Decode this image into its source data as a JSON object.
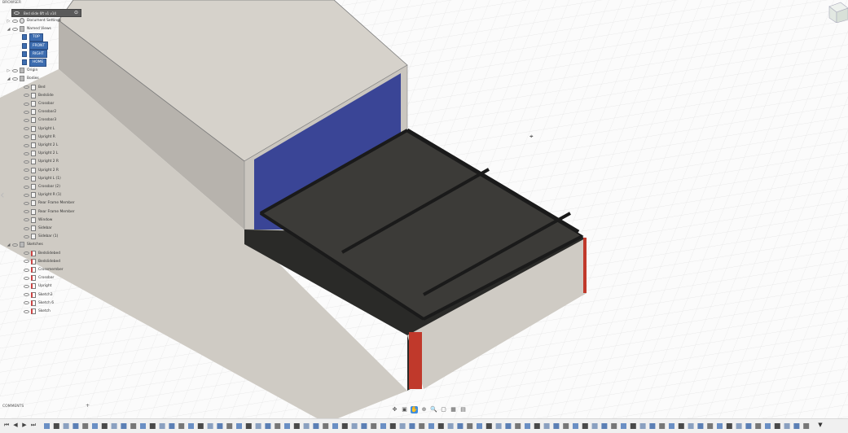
{
  "browser": {
    "title": "BROWSER",
    "document": "Bed slide 6ft v1 v14",
    "items": [
      {
        "label": "Document Settings",
        "indent": 0,
        "icon": "gear",
        "tri": "▷"
      },
      {
        "label": "Named Views",
        "indent": 0,
        "icon": "folder",
        "tri": "◢"
      },
      {
        "label": "TOP",
        "indent": 1,
        "icon": "view",
        "tri": "",
        "view": true
      },
      {
        "label": "FRONT",
        "indent": 1,
        "icon": "view",
        "tri": "",
        "view": true
      },
      {
        "label": "RIGHT",
        "indent": 1,
        "icon": "view",
        "tri": "",
        "view": true
      },
      {
        "label": "HOME",
        "indent": 1,
        "icon": "view",
        "tri": "",
        "view": true
      },
      {
        "label": "Origin",
        "indent": 0,
        "icon": "folder",
        "tri": "▷"
      },
      {
        "label": "Bodies",
        "indent": 0,
        "icon": "folder",
        "tri": "◢"
      },
      {
        "label": "Bed",
        "indent": 1,
        "icon": "body",
        "tri": ""
      },
      {
        "label": "Bedslide",
        "indent": 1,
        "icon": "body",
        "tri": ""
      },
      {
        "label": "Crossbar",
        "indent": 1,
        "icon": "body",
        "tri": ""
      },
      {
        "label": "Crossbar2",
        "indent": 1,
        "icon": "body",
        "tri": ""
      },
      {
        "label": "Crossbar3",
        "indent": 1,
        "icon": "body",
        "tri": ""
      },
      {
        "label": "Upright L",
        "indent": 1,
        "icon": "body",
        "tri": ""
      },
      {
        "label": "Upright R",
        "indent": 1,
        "icon": "body",
        "tri": ""
      },
      {
        "label": "Upright 2 L",
        "indent": 1,
        "icon": "body",
        "tri": ""
      },
      {
        "label": "Upright 2 L",
        "indent": 1,
        "icon": "body",
        "tri": ""
      },
      {
        "label": "Upright 2 R",
        "indent": 1,
        "icon": "body",
        "tri": ""
      },
      {
        "label": "Upright 2 R",
        "indent": 1,
        "icon": "body",
        "tri": ""
      },
      {
        "label": "Upright L (1)",
        "indent": 1,
        "icon": "body",
        "tri": ""
      },
      {
        "label": "Crossbar (2)",
        "indent": 1,
        "icon": "body",
        "tri": ""
      },
      {
        "label": "Upright R (1)",
        "indent": 1,
        "icon": "body",
        "tri": ""
      },
      {
        "label": "Rear Frame Member",
        "indent": 1,
        "icon": "body",
        "tri": ""
      },
      {
        "label": "Rear Frame Member",
        "indent": 1,
        "icon": "body",
        "tri": ""
      },
      {
        "label": "Window",
        "indent": 1,
        "icon": "body",
        "tri": ""
      },
      {
        "label": "Sidebar",
        "indent": 1,
        "icon": "body",
        "tri": ""
      },
      {
        "label": "Sidebar (1)",
        "indent": 1,
        "icon": "body",
        "tri": ""
      },
      {
        "label": "Sketches",
        "indent": 0,
        "icon": "folder",
        "tri": "◢"
      },
      {
        "label": "Bedslidebed",
        "indent": 1,
        "icon": "sketch",
        "tri": ""
      },
      {
        "label": "Bedslidebed",
        "indent": 1,
        "icon": "sketch",
        "tri": ""
      },
      {
        "label": "Crossmember",
        "indent": 1,
        "icon": "sketch",
        "tri": ""
      },
      {
        "label": "Crossbar",
        "indent": 1,
        "icon": "sketch",
        "tri": ""
      },
      {
        "label": "Upright",
        "indent": 1,
        "icon": "sketch",
        "tri": ""
      },
      {
        "label": "Sketch3",
        "indent": 1,
        "icon": "sketch",
        "tri": ""
      },
      {
        "label": "Sketch 6",
        "indent": 1,
        "icon": "sketch",
        "tri": ""
      },
      {
        "label": "Sketch",
        "indent": 1,
        "icon": "sketch",
        "tri": ""
      }
    ]
  },
  "comments": {
    "label": "COMMENTS",
    "add": "+"
  },
  "nav_bar": {
    "icons": [
      "✥",
      "▣",
      "✋",
      "⊕",
      "🔍",
      "▢",
      "▦",
      "▤"
    ],
    "active_index": 2
  },
  "timeline": {
    "controls": [
      "⏮",
      "◀",
      "▶",
      "⏭"
    ],
    "marker": "▼"
  },
  "colors": {
    "accent": "#3d6db0",
    "bed": "#d6d2cb",
    "slide": "#2c2c2a",
    "window": "#2f3a8a",
    "edge_red": "#c0392b"
  }
}
